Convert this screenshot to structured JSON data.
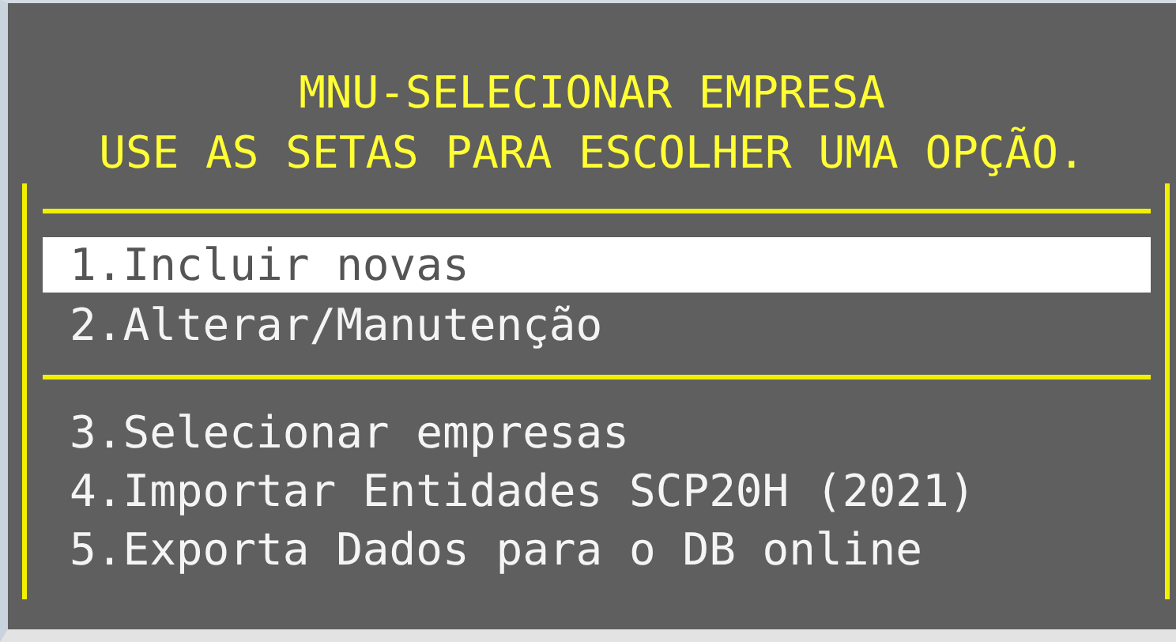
{
  "title_lines": [
    "MNU-SELECIONAR EMPRESA",
    "USE AS SETAS PARA ESCOLHER UMA OPÇÃO."
  ],
  "menu_sections": [
    {
      "items": [
        {
          "label": "1.Incluir novas",
          "selected": true
        },
        {
          "label": "2.Alterar/Manutenção",
          "selected": false
        }
      ]
    },
    {
      "items": [
        {
          "label": "3.Selecionar empresas",
          "selected": false
        },
        {
          "label": "4.Importar Entidades SCP20H (2021)",
          "selected": false
        },
        {
          "label": "5.Exporta Dados para o DB online",
          "selected": false
        }
      ]
    }
  ]
}
